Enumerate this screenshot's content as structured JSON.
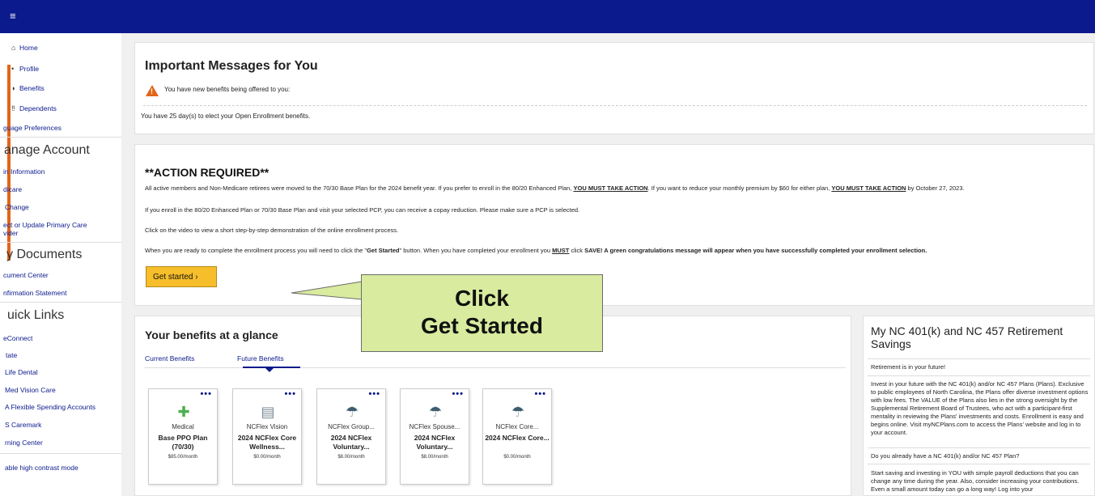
{
  "topbar": {
    "menu_glyph": "≡"
  },
  "sidebar": {
    "items": [
      {
        "label": "Home",
        "icon": "home-icon",
        "glyph": "⌂"
      },
      {
        "label": "Profile",
        "icon": "user-icon",
        "glyph": "•"
      },
      {
        "label": "Benefits",
        "icon": "benefits-icon",
        "glyph": "◗"
      },
      {
        "label": "Dependents",
        "icon": "dependents-icon",
        "glyph": "‼"
      },
      {
        "label": "guage Preferences",
        "icon": "",
        "glyph": ""
      }
    ],
    "manage_heading": "anage Account",
    "manage_items": [
      "in Information",
      "dicare",
      "Change",
      "ect or Update Primary Care",
      "vider"
    ],
    "documents_heading": "y Documents",
    "documents_items": [
      "cument Center",
      "nfirmation Statement"
    ],
    "quicklinks_heading": "uick Links",
    "quicklinks_items": [
      "eConnect",
      "tate",
      "Life Dental",
      "Med Vision Care",
      "A Flexible Spending Accounts",
      "S Caremark",
      "rning Center"
    ],
    "contrast": "able high contrast mode"
  },
  "messages": {
    "title": "Important Messages for You",
    "new_benefits": "You have new benefits being offered to you:",
    "days_left": "You have 25 day(s) to elect your Open Enrollment benefits."
  },
  "action": {
    "title": "**ACTION REQUIRED**",
    "p1_a": "All active members and Non-Medicare retirees were moved to the 70/30 Base Plan for the 2024 benefit year. If you prefer to enroll in the 80/20 Enhanced Plan, ",
    "p1_b": "YOU MUST TAKE ACTION",
    "p1_c": ". If you want to reduce your monthly premium by $60 for either plan, ",
    "p1_d": "YOU MUST TAKE ACTION",
    "p1_e": " by October 27, 2023.",
    "p2": "If you enroll in the 80/20 Enhanced Plan or 70/30 Base Plan and visit your selected PCP, you can receive a copay reduction. Please make sure a PCP is selected.",
    "p3": "Click on the video to view a short step-by-step demonstration of the online enrollment process.",
    "p4_a": "When you are ready to complete the enrollment process you will need to click the \"",
    "p4_b": "Get Started",
    "p4_c": "\" button. When you have completed your enrollment you ",
    "p4_d": "MUST",
    "p4_e": " click ",
    "p4_f": "SAVE! A green congratulations message will appear when you have successfully completed your enrollment selection.",
    "button_label": "Get started ›"
  },
  "callout": {
    "line1": "Click",
    "line2": "Get Started"
  },
  "glance": {
    "title": "Your benefits at a glance",
    "tabs": [
      "Current Benefits",
      "Future Benefits"
    ],
    "cards": [
      {
        "type": "Medical",
        "plan": "Base PPO Plan (70/30)",
        "price": "$85.00/month",
        "icon": "medical-cross-icon",
        "glyph": "✚",
        "color": "#4caf50"
      },
      {
        "type": "NCFlex Vision",
        "plan": "2024 NCFlex Core Wellness...",
        "price": "$0.00/month",
        "icon": "eye-chart-icon",
        "glyph": "▤",
        "color": "#7a8a94"
      },
      {
        "type": "NCFlex Group...",
        "plan": "2024 NCFlex Voluntary...",
        "price": "$8.00/month",
        "icon": "umbrella-icon",
        "glyph": "☂",
        "color": "#3d5d6e"
      },
      {
        "type": "NCFlex Spouse...",
        "plan": "2024 NCFlex Voluntary...",
        "price": "$8.00/month",
        "icon": "umbrella-icon",
        "glyph": "☂",
        "color": "#3d5d6e"
      },
      {
        "type": "NCFlex Core...",
        "plan": "2024 NCFlex Core...",
        "price": "$0.00/month",
        "icon": "umbrella-icon",
        "glyph": "☂",
        "color": "#3d5d6e"
      }
    ],
    "card_menu": "•••"
  },
  "retirement": {
    "title": "My NC 401(k) and NC 457 Retirement Savings",
    "subtitle": "Retirement is in your future!",
    "body1": "Invest in your future with the NC 401(k) and/or NC 457 Plans (Plans). Exclusive to public employees of North Carolina, the Plans offer diverse investment options with low fees. The VALUE of the Plans also lies in the strong oversight by the Supplemental Retirement Board of Trustees, who act with a participant-first mentality in reviewing the Plans' investments and costs. Enrollment is easy and begins online. Visit myNCPlans.com to access the Plans' website and log in to your account.",
    "question": "Do you already have a NC 401(k) and/or NC 457 Plan?",
    "body2": "Start saving and investing in YOU with simple payroll deductions that you can change any time during the year. Also, consider increasing your contributions. Even a small amount today can go a long way! Log into your"
  }
}
